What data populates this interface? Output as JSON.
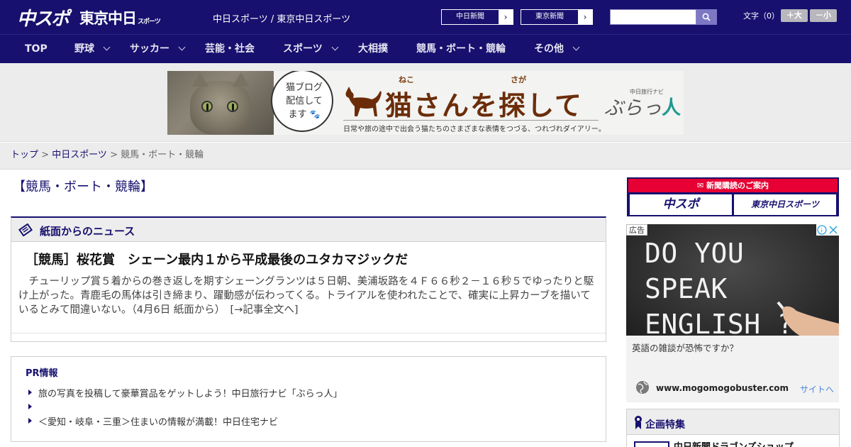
{
  "header": {
    "logo_chuspo": "中スポ",
    "logo_tokyo": "東京中日",
    "logo_tokyo_sub": "スポーツ",
    "site_title": "中日スポーツ / 東京中日スポーツ",
    "paper_links": [
      "中日新聞",
      "東京新聞"
    ],
    "font_size_label": "文字（0）",
    "font_plus": "＋大",
    "font_minus": "－小"
  },
  "nav": {
    "items": [
      {
        "label": "TOP",
        "dropdown": false
      },
      {
        "label": "野球",
        "dropdown": true
      },
      {
        "label": "サッカー",
        "dropdown": true
      },
      {
        "label": "芸能・社会",
        "dropdown": false
      },
      {
        "label": "スポーツ",
        "dropdown": true
      },
      {
        "label": "大相撲",
        "dropdown": false
      },
      {
        "label": "競馬・ボート・競輪",
        "dropdown": false
      },
      {
        "label": "その他",
        "dropdown": true
      }
    ]
  },
  "banner": {
    "speech_line1": "猫ブログ",
    "speech_line2": "配信して",
    "speech_line3": "ます",
    "ruby_neko": "ねこ",
    "ruby_saga": "さが",
    "title": "猫さんを探して",
    "navi_small": "中日旅行ナビ",
    "navi_main": "ぶらっ",
    "navi_kanji": "人",
    "subtitle": "日常や旅の途中で出会う猫たちのさまざまな表情をつづる、つれづれダイアリー。"
  },
  "breadcrumb": {
    "items": [
      "トップ",
      "中日スポーツ"
    ],
    "current": "競馬・ボート・競輪",
    "separator": " > "
  },
  "page_heading": "【競馬・ボート・競輪】",
  "news": {
    "section_title": "紙面からのニュース",
    "title": "［競馬］桜花賞　シェーン最内１から平成最後のユタカマジックだ",
    "body": "チューリップ賞５着からの巻き返しを期すシェーングランツは５日朝、美浦坂路を４Ｆ６６秒２－１６秒５でゆったりと駆け上がった。青鹿毛の馬体は引き締まり、躍動感が伝わってくる。トライアルを使われたことで、確実に上昇カーブを描いているとみて間違いない。（4月6日 紙面から）　[→記事全文へ]"
  },
  "pr": {
    "title": "PR情報",
    "items": [
      "旅の写真を投稿して豪華賞品をゲットしよう！中日旅行ナビ「ぶらっ人」",
      "",
      "＜愛知・岐阜・三重＞住まいの情報が満載！中日住宅ナビ"
    ]
  },
  "sidebar": {
    "subscribe_head": "新聞購読のご案内",
    "subscribe_buttons": [
      "中スポ",
      "東京中日スポーツ"
    ],
    "ad": {
      "badge": "広告",
      "chalk_line1": "DO YOU SPEAK",
      "chalk_line2": "ENGLISH ?",
      "caption": "英語の雑談が恐怖ですか？",
      "url": "www.mogomogobuster.com",
      "link": "サイトへ"
    },
    "feature_title": "企画特集",
    "feature_item": "中日新聞ドラゴンズショップ"
  },
  "colors": {
    "navy": "#17106e",
    "red": "#e60033",
    "link_blue": "#4a86d8"
  }
}
